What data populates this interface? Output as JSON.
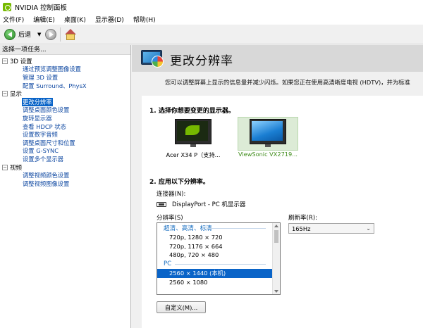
{
  "window": {
    "title": "NVIDIA 控制面板"
  },
  "menu": [
    "文件(F)",
    "编辑(E)",
    "桌面(K)",
    "显示器(D)",
    "帮助(H)"
  ],
  "toolbar": {
    "back_label": "后退"
  },
  "left_panel": {
    "header": "选择一项任务...",
    "categories": [
      {
        "label": "3D 设置",
        "toggle": "⊟",
        "items": [
          {
            "label": "通过预览调整图像设置",
            "selected": false
          },
          {
            "label": "管理 3D 设置",
            "selected": false
          },
          {
            "label": "配置 Surround、PhysX",
            "selected": false
          }
        ]
      },
      {
        "label": "显示",
        "toggle": "⊟",
        "items": [
          {
            "label": "更改分辨率",
            "selected": true
          },
          {
            "label": "调整桌面颜色设置",
            "selected": false
          },
          {
            "label": "旋转显示器",
            "selected": false
          },
          {
            "label": "查看 HDCP 状态",
            "selected": false
          },
          {
            "label": "设置数字音频",
            "selected": false
          },
          {
            "label": "调整桌面尺寸和位置",
            "selected": false
          },
          {
            "label": "设置 G-SYNC",
            "selected": false
          },
          {
            "label": "设置多个显示器",
            "selected": false
          }
        ]
      },
      {
        "label": "视频",
        "toggle": "⊟",
        "items": [
          {
            "label": "调整视频颜色设置",
            "selected": false
          },
          {
            "label": "调整视频图像设置",
            "selected": false
          }
        ]
      }
    ]
  },
  "page": {
    "title": "更改分辨率",
    "description": "您可以调整屏幕上显示的信息量并减少闪烁。如果您正在使用高清晰度电视 (HDTV)，并为标准",
    "step1_title": "1. 选择你想要变更的显示器。",
    "displays": [
      {
        "label": "Acer X34 P（支持...",
        "icon": "nvidia-monitor-icon",
        "selected": false
      },
      {
        "label": "ViewSonic VX2719...",
        "icon": "monitor-icon",
        "selected": true
      }
    ],
    "step2_title": "2. 应用以下分辨率。",
    "connector_label": "连接器(N):",
    "connector_value": "DisplayPort - PC 机显示器",
    "resolution_label": "分辨率(S)",
    "refresh_label": "刷新率(R):",
    "refresh_value": "165Hz",
    "resolution_groups": [
      {
        "name": "超清、高清、标清",
        "items": [
          {
            "label": "720p, 1280 × 720",
            "selected": false
          },
          {
            "label": "720p, 1176 × 664",
            "selected": false
          },
          {
            "label": "480p, 720 × 480",
            "selected": false
          }
        ]
      },
      {
        "name": "PC",
        "items": [
          {
            "label": "2560 × 1440 (本机)",
            "selected": true
          },
          {
            "label": "2560 × 1080",
            "selected": false
          }
        ]
      }
    ],
    "custom_button": "自定义(M)..."
  },
  "colors": {
    "accent_green": "#76b900",
    "selection_blue": "#0a64c8",
    "link_blue": "#0d47a1"
  }
}
